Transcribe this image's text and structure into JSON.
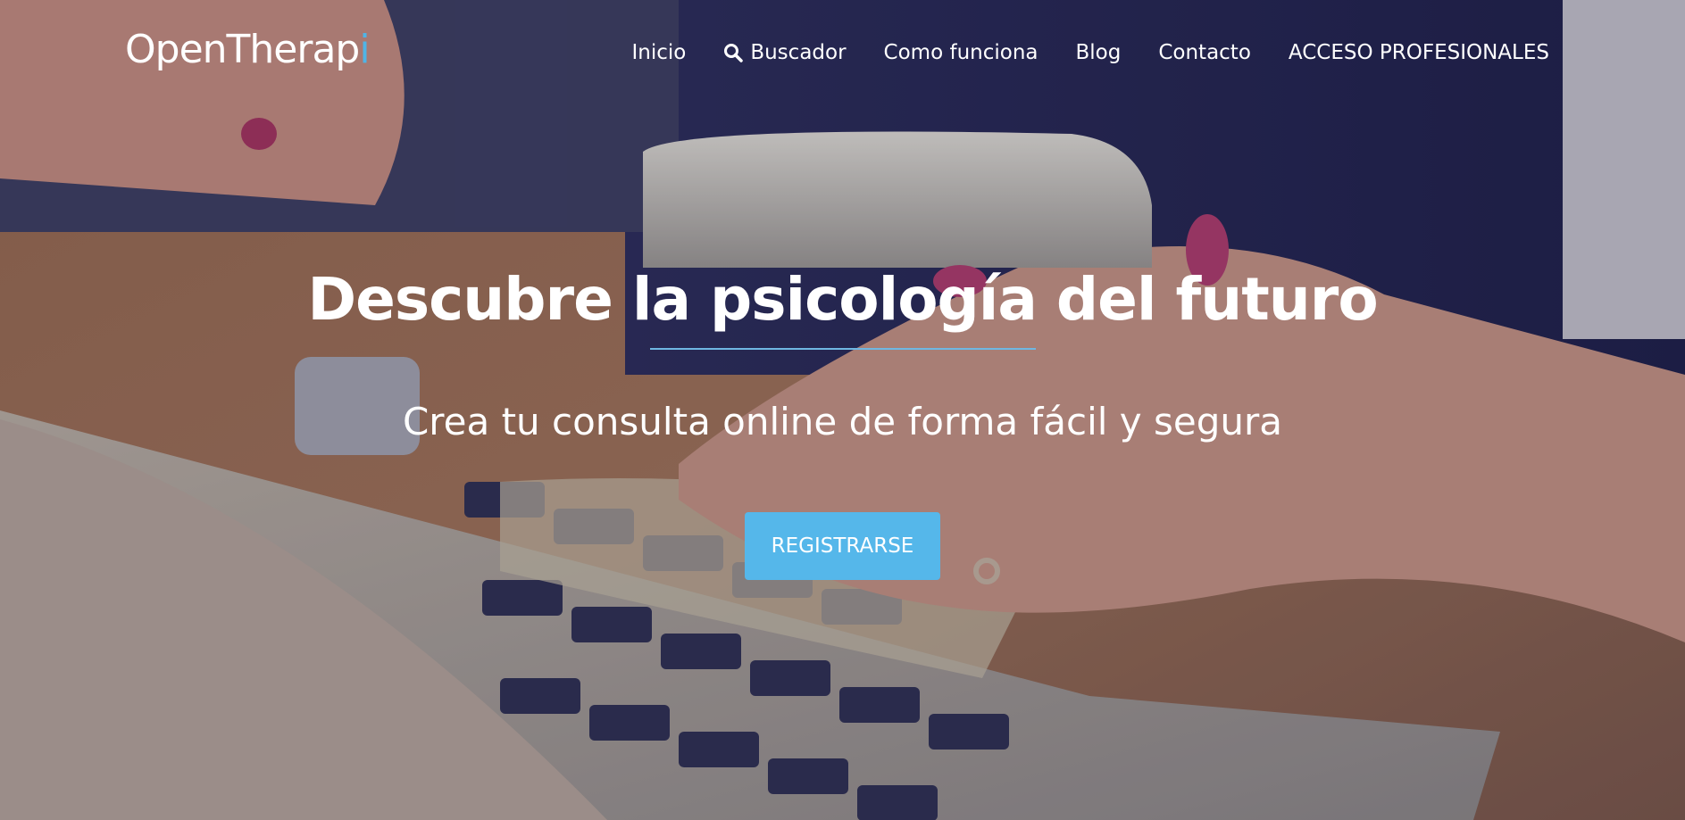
{
  "logo": {
    "main": "OpenTherap",
    "accent": "i"
  },
  "nav": {
    "items": [
      {
        "label": "Inicio"
      },
      {
        "label": "Buscador",
        "icon": "search-icon"
      },
      {
        "label": "Como funciona"
      },
      {
        "label": "Blog"
      },
      {
        "label": "Contacto"
      },
      {
        "label": "ACCESO PROFESIONALES"
      }
    ]
  },
  "hero": {
    "headline": "Descubre la psicología del futuro",
    "subheadline": "Crea tu consulta online de forma fácil y segura",
    "cta_label": "REGISTRARSE"
  },
  "colors": {
    "accent": "#55b7ea",
    "logo_accent": "#4fb4e6",
    "text": "#ffffff"
  }
}
